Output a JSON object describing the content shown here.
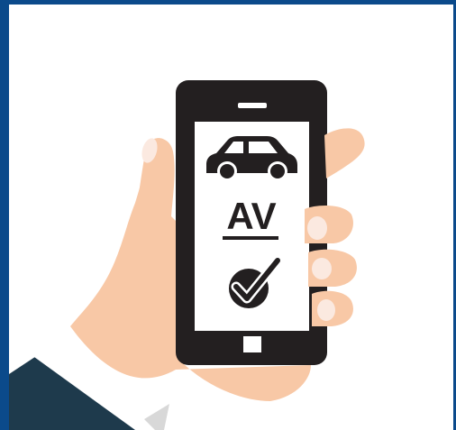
{
  "screen": {
    "label": "AV"
  },
  "icons": {
    "car": "car-icon",
    "check": "checkmark-icon",
    "home": "home-button"
  },
  "colors": {
    "frame": "#0b4a8b",
    "phone": "#231f20",
    "screen": "#ffffff",
    "skin": "#f8c8a6",
    "skin_shadow": "#eab28f",
    "nail": "#fbe9e0",
    "cuff": "#ffffff",
    "cuff_shadow": "#d8d8d8",
    "sleeve": "#1e3a4c",
    "sleeve_shadow": "#16303f"
  }
}
